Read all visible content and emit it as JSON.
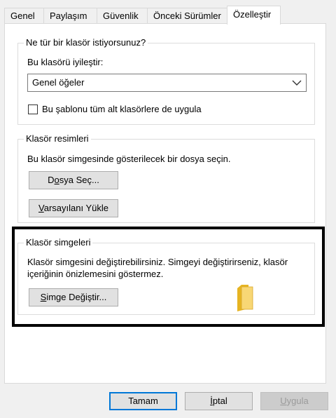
{
  "tabs": [
    "Genel",
    "Paylaşım",
    "Güvenlik",
    "Önceki Sürümler",
    "Özelleştir"
  ],
  "active_tab": "Özelleştir",
  "optimize": {
    "title": "Ne tür bir klasör istiyorsunuz?",
    "label": "Bu klasörü iyileştir:",
    "selected_value": "Genel öğeler",
    "checkbox_label": "Bu şablonu tüm alt klasörlere de uygula",
    "checkbox_checked": false
  },
  "folder_pictures": {
    "title": "Klasör resimleri",
    "description": "Bu klasör simgesinde gösterilecek bir dosya seçin.",
    "choose_file_prefix": "D",
    "choose_file_u": "o",
    "choose_file_suffix": "sya Seç...",
    "restore_u": "V",
    "restore_suffix": "arsayılanı Yükle"
  },
  "folder_icons": {
    "title": "Klasör simgeleri",
    "description_line1": "Klasör simgesini değiştirebilirsiniz. Simgeyi değiştirirseniz, klasör",
    "description_line2": "içeriğinin önizlemesini göstermez.",
    "change_u": "S",
    "change_suffix": "imge Değiştir...",
    "preview_icon": "folder-icon"
  },
  "dialog_buttons": {
    "ok": "Tamam",
    "cancel_u": "İ",
    "cancel_suffix": "ptal",
    "apply_u": "U",
    "apply_suffix": "ygula",
    "apply_disabled": true
  },
  "colors": {
    "default_button_border": "#0078d7",
    "highlight_border": "#000000",
    "folder_yellow": "#f8d775"
  }
}
